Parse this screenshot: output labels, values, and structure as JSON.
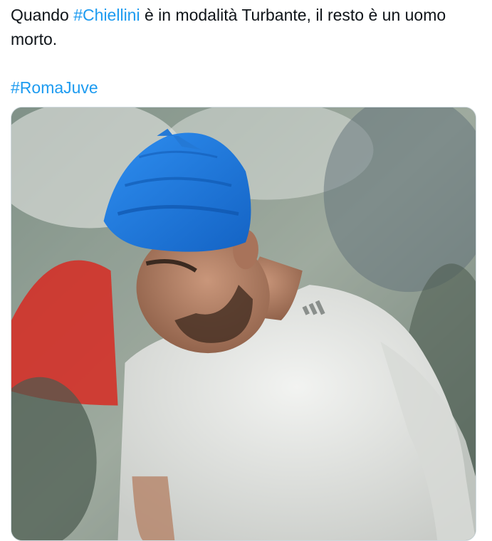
{
  "tweet": {
    "text_part1": "Quando ",
    "hashtag1": "#Chiellini",
    "text_part2": " è in modalità Turbante, il resto è un uomo morto.",
    "hashtag2": "#RomaJuve"
  },
  "colors": {
    "hashtag": "#1d9bf0",
    "text": "#0f1419",
    "bandage": "#1f7fe0",
    "shirt": "#e9ebe8"
  },
  "media": {
    "subject": "photo-player-with-blue-head-bandage"
  }
}
